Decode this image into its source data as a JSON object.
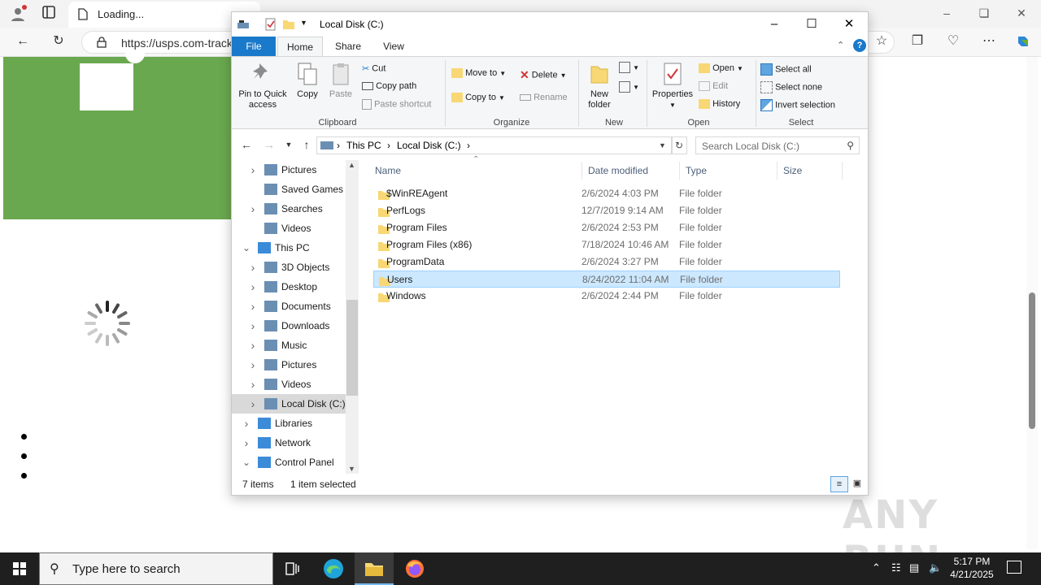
{
  "browser": {
    "tab_title": "Loading...",
    "url": "https://usps.com-track"
  },
  "explorer": {
    "title": "Local Disk (C:)",
    "ribbon_tabs": {
      "file": "File",
      "home": "Home",
      "share": "Share",
      "view": "View"
    },
    "clipboard": {
      "pin": "Pin to Quick access",
      "pin_l1": "Pin to Quick",
      "pin_l2": "access",
      "copy": "Copy",
      "paste": "Paste",
      "cut": "Cut",
      "copy_path": "Copy path",
      "paste_shortcut": "Paste shortcut",
      "label": "Clipboard"
    },
    "organize": {
      "move_to": "Move to",
      "copy_to": "Copy to",
      "delete": "Delete",
      "rename": "Rename",
      "label": "Organize"
    },
    "new": {
      "new_folder_l1": "New",
      "new_folder_l2": "folder",
      "label": "New"
    },
    "open": {
      "properties": "Properties",
      "open": "Open",
      "edit": "Edit",
      "history": "History",
      "label": "Open"
    },
    "select": {
      "select_all": "Select all",
      "select_none": "Select none",
      "invert": "Invert selection",
      "label": "Select"
    },
    "breadcrumb": [
      "This PC",
      "Local Disk (C:)"
    ],
    "search_placeholder": "Search Local Disk (C:)",
    "nav_tree": [
      {
        "label": "Pictures",
        "level": 2,
        "expander": ">"
      },
      {
        "label": "Saved Games",
        "level": 2,
        "expander": ""
      },
      {
        "label": "Searches",
        "level": 2,
        "expander": ">"
      },
      {
        "label": "Videos",
        "level": 2,
        "expander": ""
      },
      {
        "label": "This PC",
        "level": 1,
        "expander": "v"
      },
      {
        "label": "3D Objects",
        "level": 2,
        "expander": ">"
      },
      {
        "label": "Desktop",
        "level": 2,
        "expander": ">"
      },
      {
        "label": "Documents",
        "level": 2,
        "expander": ">"
      },
      {
        "label": "Downloads",
        "level": 2,
        "expander": ">"
      },
      {
        "label": "Music",
        "level": 2,
        "expander": ">"
      },
      {
        "label": "Pictures",
        "level": 2,
        "expander": ">"
      },
      {
        "label": "Videos",
        "level": 2,
        "expander": ">"
      },
      {
        "label": "Local Disk (C:)",
        "level": 2,
        "expander": ">",
        "selected": true
      },
      {
        "label": "Libraries",
        "level": 1,
        "expander": ">"
      },
      {
        "label": "Network",
        "level": 1,
        "expander": ">"
      },
      {
        "label": "Control Panel",
        "level": 1,
        "expander": "v"
      }
    ],
    "columns": {
      "name": "Name",
      "date": "Date modified",
      "type": "Type",
      "size": "Size"
    },
    "files": [
      {
        "name": "$WinREAgent",
        "date": "2/6/2024 4:03 PM",
        "type": "File folder"
      },
      {
        "name": "PerfLogs",
        "date": "12/7/2019 9:14 AM",
        "type": "File folder"
      },
      {
        "name": "Program Files",
        "date": "2/6/2024 2:53 PM",
        "type": "File folder"
      },
      {
        "name": "Program Files (x86)",
        "date": "7/18/2024 10:46 AM",
        "type": "File folder"
      },
      {
        "name": "ProgramData",
        "date": "2/6/2024 3:27 PM",
        "type": "File folder"
      },
      {
        "name": "Users",
        "date": "8/24/2022 11:04 AM",
        "type": "File folder",
        "selected": true
      },
      {
        "name": "Windows",
        "date": "2/6/2024 2:44 PM",
        "type": "File folder"
      }
    ],
    "status": {
      "count": "7 items",
      "selection": "1 item selected"
    }
  },
  "taskbar": {
    "search_placeholder": "Type here to search",
    "time": "5:17 PM",
    "date": "4/21/2025"
  },
  "watermark": "ANY RUN",
  "colors": {
    "accent": "#1979ca",
    "selection": "#cce8ff",
    "hero_green": "#6aa84f",
    "folder": "#f8d775"
  }
}
